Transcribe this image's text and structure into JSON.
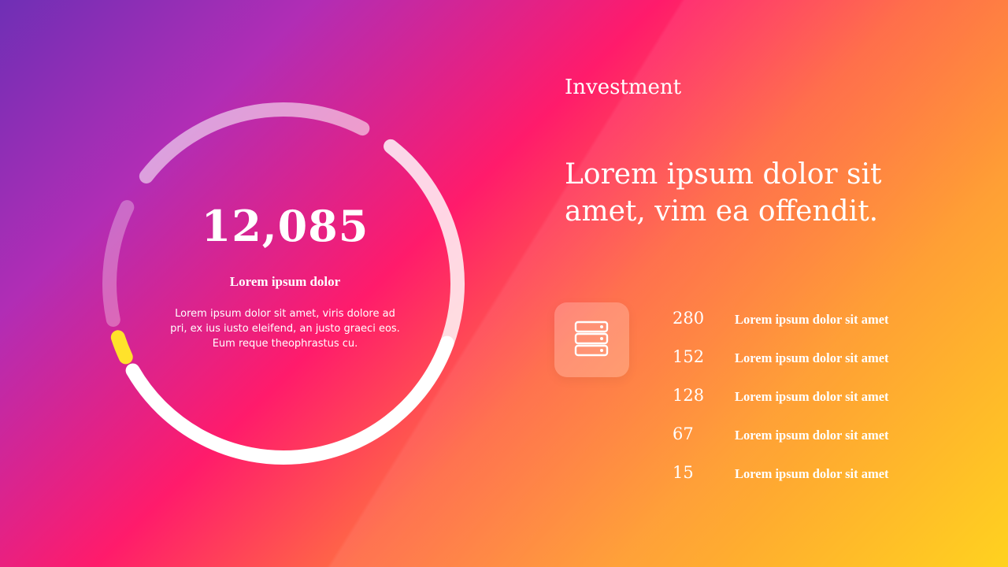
{
  "diagram": {
    "progress_ring": {
      "segments": [
        {
          "name": "main",
          "start_deg": 20,
          "end_deg": 150,
          "color": "#ffffff",
          "opacity": 1.0
        },
        {
          "name": "accent",
          "start_deg": 155,
          "end_deg": 162,
          "color": "#ffe22b",
          "opacity": 1.0
        },
        {
          "name": "lower-left",
          "start_deg": 168,
          "end_deg": 206,
          "color": "#ffffff",
          "opacity": 0.3
        },
        {
          "name": "upper-left",
          "start_deg": 218,
          "end_deg": 297,
          "color": "#ffffff",
          "opacity": 0.55
        },
        {
          "name": "top",
          "start_deg": 308,
          "end_deg": 399,
          "color": "#ffffff",
          "opacity": 0.82
        }
      ]
    },
    "center": {
      "value": "12,085",
      "heading": "Lorem ipsum dolor",
      "body": "Lorem ipsum dolor sit amet, viris dolore ad pri, ex ius iusto eleifend, an justo graeci eos. Eum reque theophrastus cu."
    }
  },
  "panel": {
    "title": "Investment",
    "headline": "Lorem ipsum dolor sit amet, vim ea offendit.",
    "icon": "server-stack-icon",
    "stats": [
      {
        "value": "280",
        "label": "Lorem ipsum dolor sit amet"
      },
      {
        "value": "152",
        "label": "Lorem ipsum dolor sit amet"
      },
      {
        "value": "128",
        "label": "Lorem ipsum dolor sit amet"
      },
      {
        "value": "67",
        "label": "Lorem ipsum dolor sit amet"
      },
      {
        "value": "15",
        "label": "Lorem ipsum dolor sit amet"
      }
    ]
  },
  "colors": {
    "gradient_start": "#6f2fb5",
    "gradient_mid": "#ff1b6b",
    "gradient_end": "#ffd21f",
    "accent": "#ffe22b"
  }
}
